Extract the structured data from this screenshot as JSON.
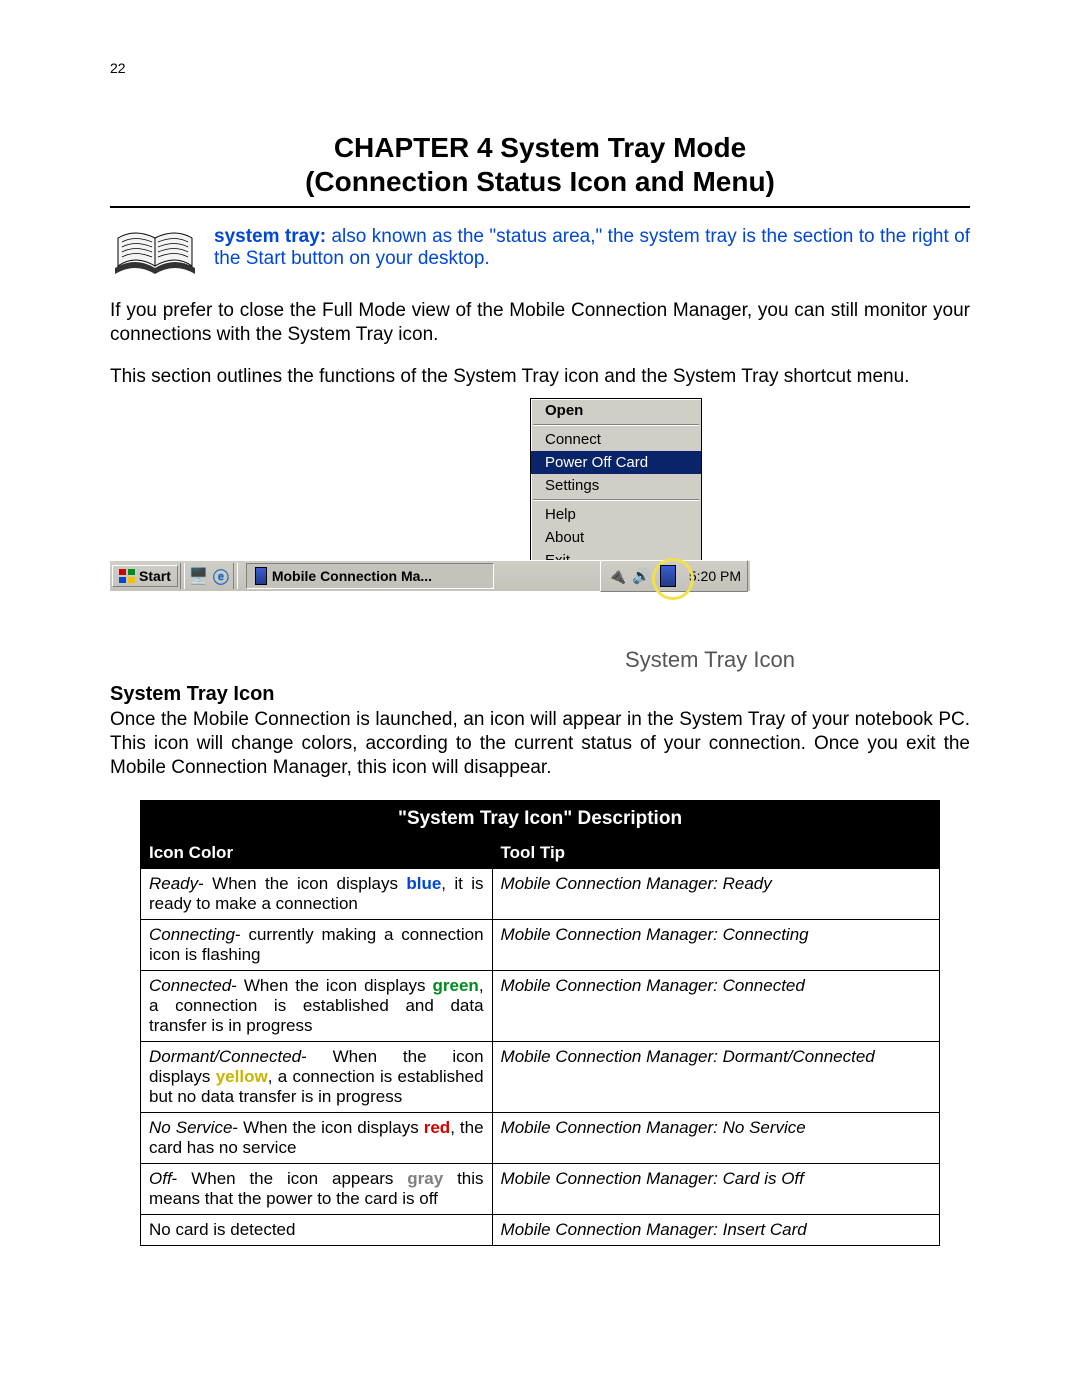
{
  "page_number": "22",
  "chapter_title_line1": "CHAPTER 4 System Tray Mode",
  "chapter_title_line2": "(Connection Status Icon and Menu)",
  "definition": {
    "term": "system tray:",
    "text": " also known as the \"status area,\" the system tray is the section to the right of the Start button on your desktop."
  },
  "paragraph1": "If you prefer to close the Full Mode view of the Mobile Connection Manager, you can still monitor your connections with the System Tray icon.",
  "paragraph2": "This section outlines the functions of the System Tray icon and the System Tray shortcut menu.",
  "context_menu": {
    "open": "Open",
    "connect": "Connect",
    "power_off": "Power Off Card",
    "settings": "Settings",
    "help": "Help",
    "about": "About",
    "exit": "Exit"
  },
  "taskbar": {
    "start": "Start",
    "task_label": "Mobile Connection Ma...",
    "clock": "5:20 PM"
  },
  "tray_caption": "System Tray Icon",
  "section_heading": "System Tray Icon",
  "section_paragraph": "Once the Mobile Connection is launched, an icon will appear in the System Tray of your notebook PC. This icon will change colors, according to the current status of your connection. Once you exit the Mobile Connection Manager, this icon will disappear.",
  "table": {
    "title": "\"System Tray Icon\" Description",
    "col1": "Icon Color",
    "col2": "Tool Tip",
    "rows": [
      {
        "state": "Ready",
        "desc_before": "- When the icon displays ",
        "color_word": "blue",
        "color_class": "clr-blue",
        "desc_after": ", it is ready to make a connection",
        "tooltip": "Mobile Connection Manager: Ready"
      },
      {
        "state": "Connecting",
        "desc_before": "- currently making a connection icon is flashing",
        "color_word": "",
        "color_class": "",
        "desc_after": "",
        "tooltip": "Mobile Connection Manager: Connecting"
      },
      {
        "state": "Connected",
        "desc_before": "- When the icon displays ",
        "color_word": "green",
        "color_class": "clr-green",
        "desc_after": ", a connection is established and data transfer is in progress",
        "tooltip": "Mobile Connection Manager: Connected"
      },
      {
        "state": "Dormant/Connected",
        "desc_before": "- When the icon displays ",
        "color_word": "yellow",
        "color_class": "clr-yellow",
        "desc_after": ", a connection is established but no data transfer is in progress",
        "tooltip": "Mobile Connection Manager:  Dormant/Connected"
      },
      {
        "state": "No Service",
        "desc_before": "- When the icon displays ",
        "color_word": "red",
        "color_class": "clr-red",
        "desc_after": ", the card has no service",
        "tooltip": "Mobile Connection Manager:  No Service"
      },
      {
        "state": "Off",
        "desc_before": "- When the icon appears ",
        "color_word": "gray",
        "color_class": "clr-gray",
        "desc_after": " this means that the power to the card is off",
        "tooltip": "Mobile Connection Manager:  Card is Off"
      },
      {
        "state": "",
        "desc_before": "No card is detected",
        "color_word": "",
        "color_class": "",
        "desc_after": "",
        "tooltip": "Mobile Connection Manager: Insert Card"
      }
    ]
  }
}
